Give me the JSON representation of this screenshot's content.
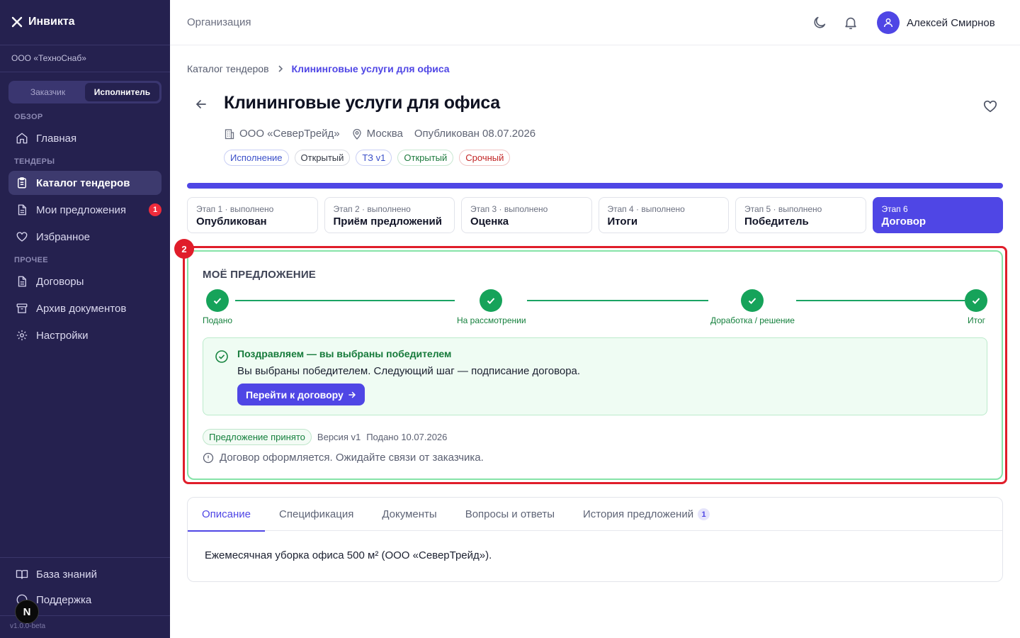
{
  "app": {
    "name": "Инвикта",
    "version": "v1.0.0-beta"
  },
  "sidebar": {
    "org": "ООО «ТехноСнаб»",
    "roles": [
      "Заказчик",
      "Исполнитель"
    ],
    "active_role": "Исполнитель",
    "sections": {
      "overview": "ОБЗОР",
      "tenders": "ТЕНДЕРЫ",
      "other": "ПРОЧЕЕ"
    },
    "items": {
      "home": "Главная",
      "catalog": "Каталог тендеров",
      "offers": "Мои предложения",
      "offers_badge": "1",
      "favorites": "Избранное",
      "contracts": "Договоры",
      "archive": "Архив документов",
      "settings": "Настройки",
      "knowledge": "База знаний",
      "support": "Поддержка"
    },
    "next_badge": "N"
  },
  "header": {
    "title": "Организация",
    "user_name": "Алексей Смирнов"
  },
  "breadcrumb": {
    "parent": "Каталог тендеров",
    "current": "Клининговые услуги для офиса"
  },
  "tender": {
    "title": "Клининговые услуги для офиса",
    "company": "ООО «СеверТрейд»",
    "city": "Москва",
    "published": "Опубликован 08.07.2026",
    "tags": [
      "Исполнение",
      "Открытый",
      "ТЗ v1",
      "Открытый",
      "Срочный"
    ]
  },
  "stages": [
    {
      "sub": "Этап 1 · выполнено",
      "title": "Опубликован"
    },
    {
      "sub": "Этап 2 · выполнено",
      "title": "Приём предложений"
    },
    {
      "sub": "Этап 3 · выполнено",
      "title": "Оценка"
    },
    {
      "sub": "Этап 4 · выполнено",
      "title": "Итоги"
    },
    {
      "sub": "Этап 5 · выполнено",
      "title": "Победитель"
    },
    {
      "sub": "Этап 6",
      "title": "Договор"
    }
  ],
  "highlight_number": "2",
  "offer": {
    "title": "МОЁ ПРЕДЛОЖЕНИЕ",
    "steps": [
      "Подано",
      "На рассмотрении",
      "Доработка / решение",
      "Итог"
    ],
    "success_title": "Поздравляем — вы выбраны победителем",
    "success_text": "Вы выбраны победителем. Следующий шаг — подписание договора.",
    "cta": "Перейти к договору",
    "status": "Предложение принято",
    "version": "Версия v1",
    "submitted": "Подано 10.07.2026",
    "info": "Договор оформляется. Ожидайте связи от заказчика."
  },
  "tabs": {
    "items": [
      "Описание",
      "Спецификация",
      "Документы",
      "Вопросы и ответы",
      "История предложений"
    ],
    "history_count": "1",
    "active": "Описание",
    "content": "Ежемесячная уборка офиса 500 м² (ООО «СеверТрейд»)."
  },
  "colors": {
    "sidebar_bg": "#25214f",
    "accent": "#4f46e5",
    "success": "#16a35a",
    "danger": "#e01d2a"
  }
}
